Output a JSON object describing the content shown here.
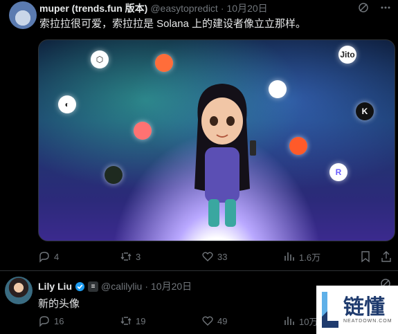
{
  "tweets": [
    {
      "display_name": "muper (trends.fun 版本)",
      "handle": "@easytopredict",
      "separator": "·",
      "date": "10月20日",
      "text": "索拉拉很可爱，索拉拉是 Solana 上的建设者像立立那样。",
      "stats": {
        "replies": "4",
        "retweets": "3",
        "likes": "33",
        "views": "1.6万"
      },
      "media_icons": [
        "Jito",
        "K",
        "R"
      ]
    },
    {
      "display_name": "Lily Liu",
      "handle": "@calilyliu",
      "separator": "·",
      "date": "10月20日",
      "text": "新的头像",
      "stats": {
        "replies": "16",
        "retweets": "19",
        "likes": "49",
        "views": "10万"
      }
    }
  ],
  "watermark": {
    "main": "链懂",
    "sub": "NEATDOWN.COM"
  },
  "colors": {
    "background": "#000000",
    "text": "#e7e9ea",
    "muted": "#71767b",
    "verified": "#1d9bf0"
  }
}
